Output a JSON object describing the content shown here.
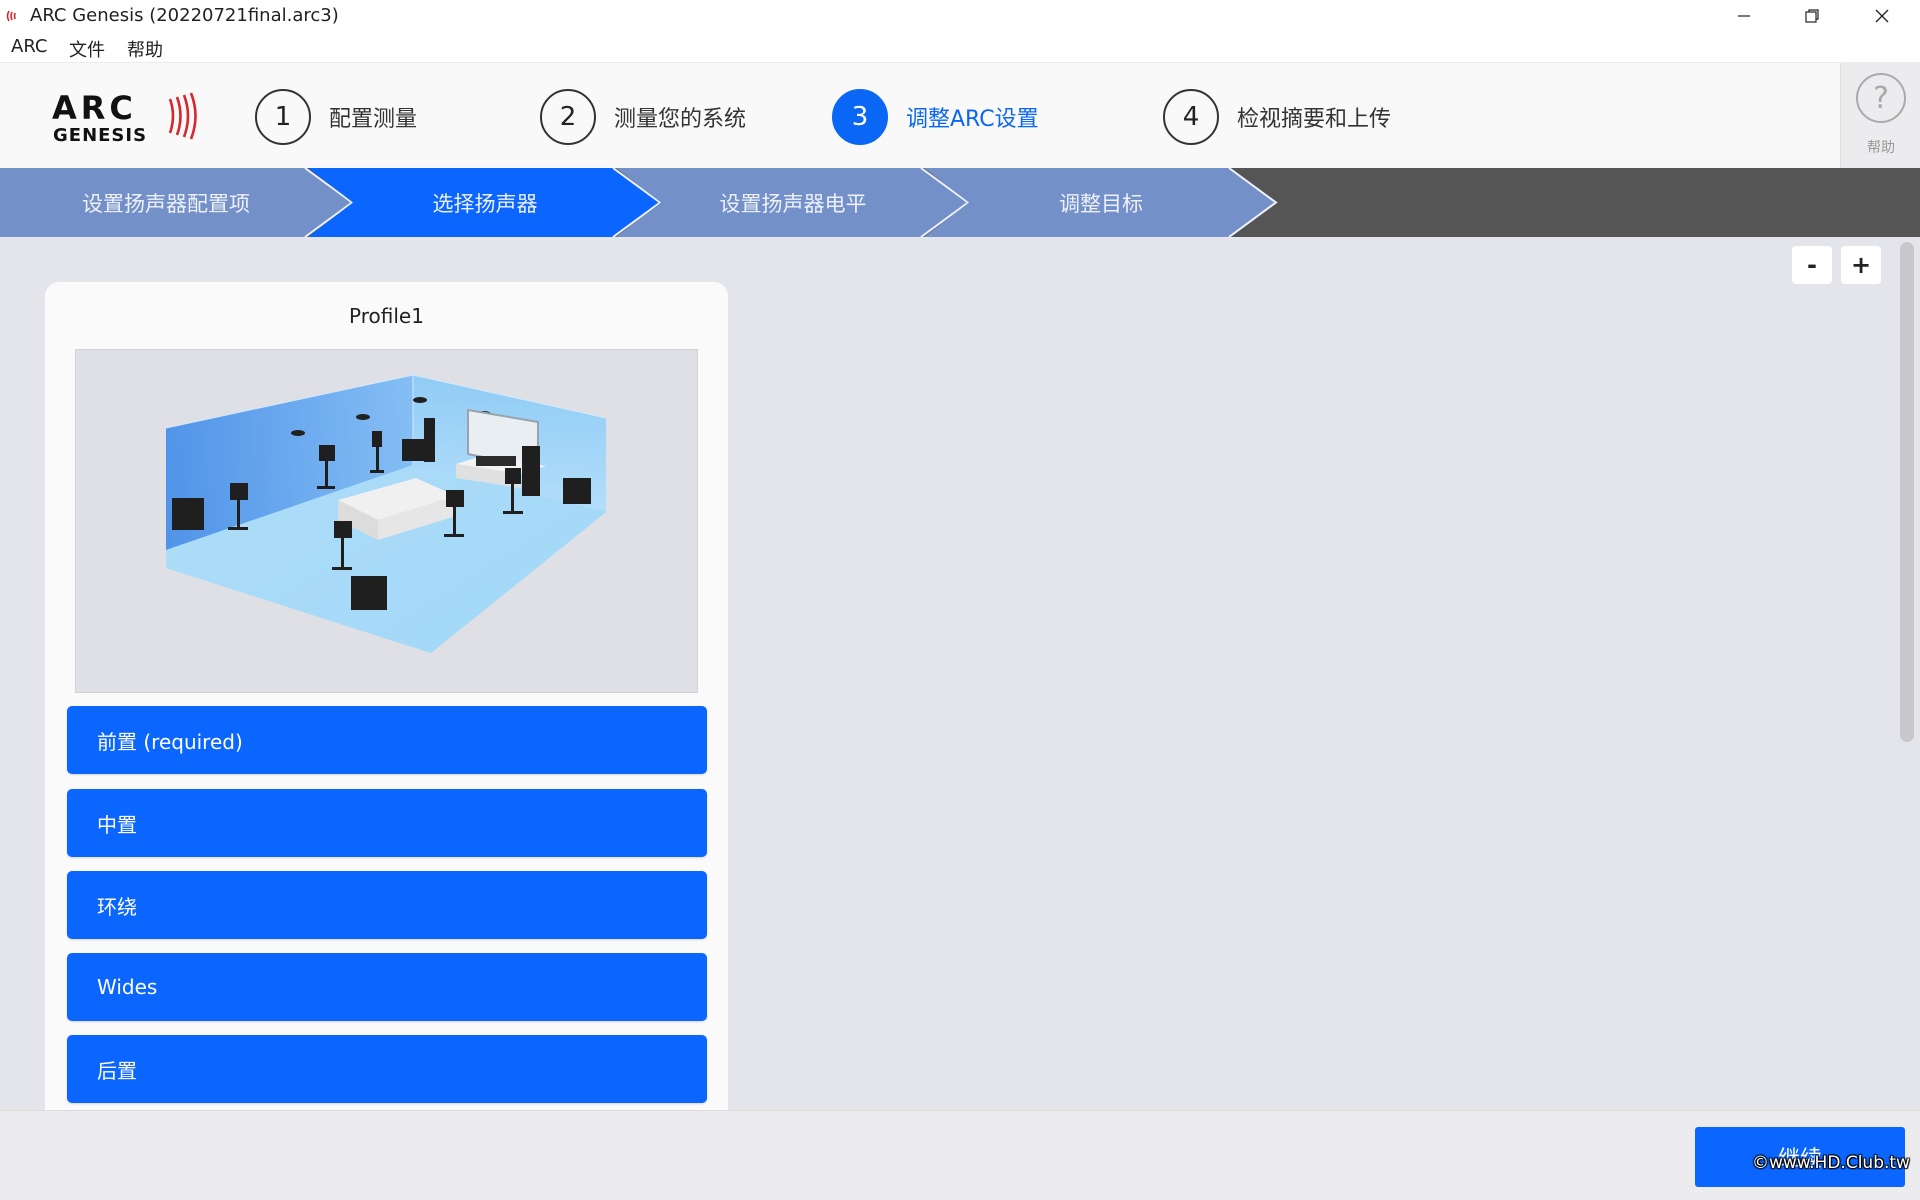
{
  "window": {
    "title": "ARC Genesis (20220721final.arc3)",
    "minimize_icon": "minimize-icon",
    "maximize_icon": "restore-icon",
    "close_icon": "close-icon"
  },
  "menu": {
    "items": [
      "ARC",
      "文件",
      "帮助"
    ]
  },
  "logo": {
    "line1": "ARC",
    "line2": "GENESIS",
    "brand_color": "#111111",
    "wave_color": "#d9262c"
  },
  "steps": [
    {
      "number": "1",
      "label": "配置测量",
      "active": false
    },
    {
      "number": "2",
      "label": "测量您的系统",
      "active": false
    },
    {
      "number": "3",
      "label": "调整ARC设置",
      "active": true
    },
    {
      "number": "4",
      "label": "检视摘要和上传",
      "active": false
    }
  ],
  "help": {
    "icon": "?",
    "label": "帮助"
  },
  "subtabs": [
    {
      "label": "设置扬声器配置项",
      "active": false
    },
    {
      "label": "选择扬声器",
      "active": true
    },
    {
      "label": "设置扬声器电平",
      "active": false
    },
    {
      "label": "调整目标",
      "active": false
    }
  ],
  "zoom": {
    "minus": "-",
    "plus": "+"
  },
  "profile": {
    "name": "Profile1",
    "speaker_groups": [
      "前置 (required)",
      "中置",
      "环绕",
      "Wides",
      "后置"
    ]
  },
  "footer": {
    "continue_label": "继续",
    "watermark": "©www.HD.Club.tw"
  },
  "colors": {
    "accent": "#0a66ff",
    "tab_inactive": "#7391c8",
    "tab_active": "#0a66ff",
    "tab_bar_bg": "#555555",
    "background": "#e4e5ea"
  }
}
